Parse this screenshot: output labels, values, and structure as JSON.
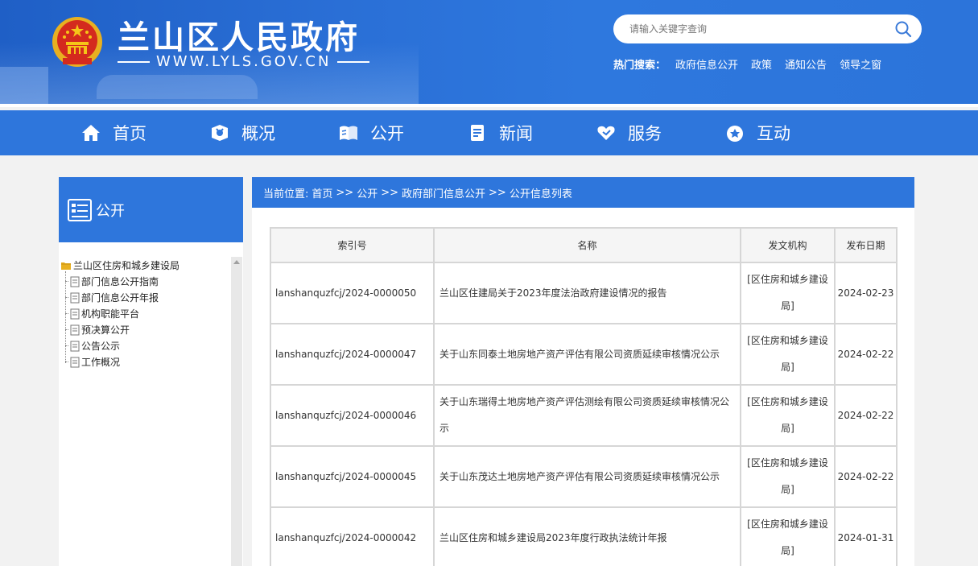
{
  "header": {
    "site_title": "兰山区人民政府",
    "site_url": "WWW.LYLS.GOV.CN",
    "search_placeholder": "请输入关键字查询",
    "hot_label": "热门搜索：",
    "hot_links": [
      "政府信息公开",
      "政策",
      "通知公告",
      "领导之窗"
    ]
  },
  "nav": {
    "items": [
      {
        "label": "首页",
        "icon": "home-icon"
      },
      {
        "label": "概况",
        "icon": "overview-icon"
      },
      {
        "label": "公开",
        "icon": "open-book-icon"
      },
      {
        "label": "新闻",
        "icon": "news-icon"
      },
      {
        "label": "服务",
        "icon": "heart-service-icon"
      },
      {
        "label": "互动",
        "icon": "interact-icon"
      }
    ]
  },
  "sidebar": {
    "title": "公开",
    "root": "兰山区住房和城乡建设局",
    "items": [
      "部门信息公开指南",
      "部门信息公开年报",
      "机构职能平台",
      "预决算公开",
      "公告公示",
      "工作概况"
    ]
  },
  "breadcrumb": {
    "prefix": "当前位置:",
    "items": [
      "首页",
      "公开",
      "政府部门信息公开",
      "公开信息列表"
    ],
    "separator": ">>"
  },
  "table": {
    "headers": [
      "索引号",
      "名称",
      "发文机构",
      "发布日期"
    ],
    "rows": [
      {
        "index": "lanshanquzfcj/2024-0000050",
        "name": "兰山区住建局关于2023年度法治政府建设情况的报告",
        "org": "[区住房和城乡建设局]",
        "date": "2024-02-23"
      },
      {
        "index": "lanshanquzfcj/2024-0000047",
        "name": "关于山东同泰土地房地产资产评估有限公司资质延续审核情况公示",
        "org": "[区住房和城乡建设局]",
        "date": "2024-02-22"
      },
      {
        "index": "lanshanquzfcj/2024-0000046",
        "name": "关于山东瑞得土地房地产资产评估测绘有限公司资质延续审核情况公示",
        "org": "[区住房和城乡建设局]",
        "date": "2024-02-22"
      },
      {
        "index": "lanshanquzfcj/2024-0000045",
        "name": "关于山东茂达土地房地产资产评估有限公司资质延续审核情况公示",
        "org": "[区住房和城乡建设局]",
        "date": "2024-02-22"
      },
      {
        "index": "lanshanquzfcj/2024-0000042",
        "name": "兰山区住房和城乡建设局2023年度行政执法统计年报",
        "org": "[区住房和城乡建设局]",
        "date": "2024-01-31"
      }
    ]
  },
  "colors": {
    "brand_blue": "#2e76dc",
    "header_blue": "#2a6fd6"
  }
}
